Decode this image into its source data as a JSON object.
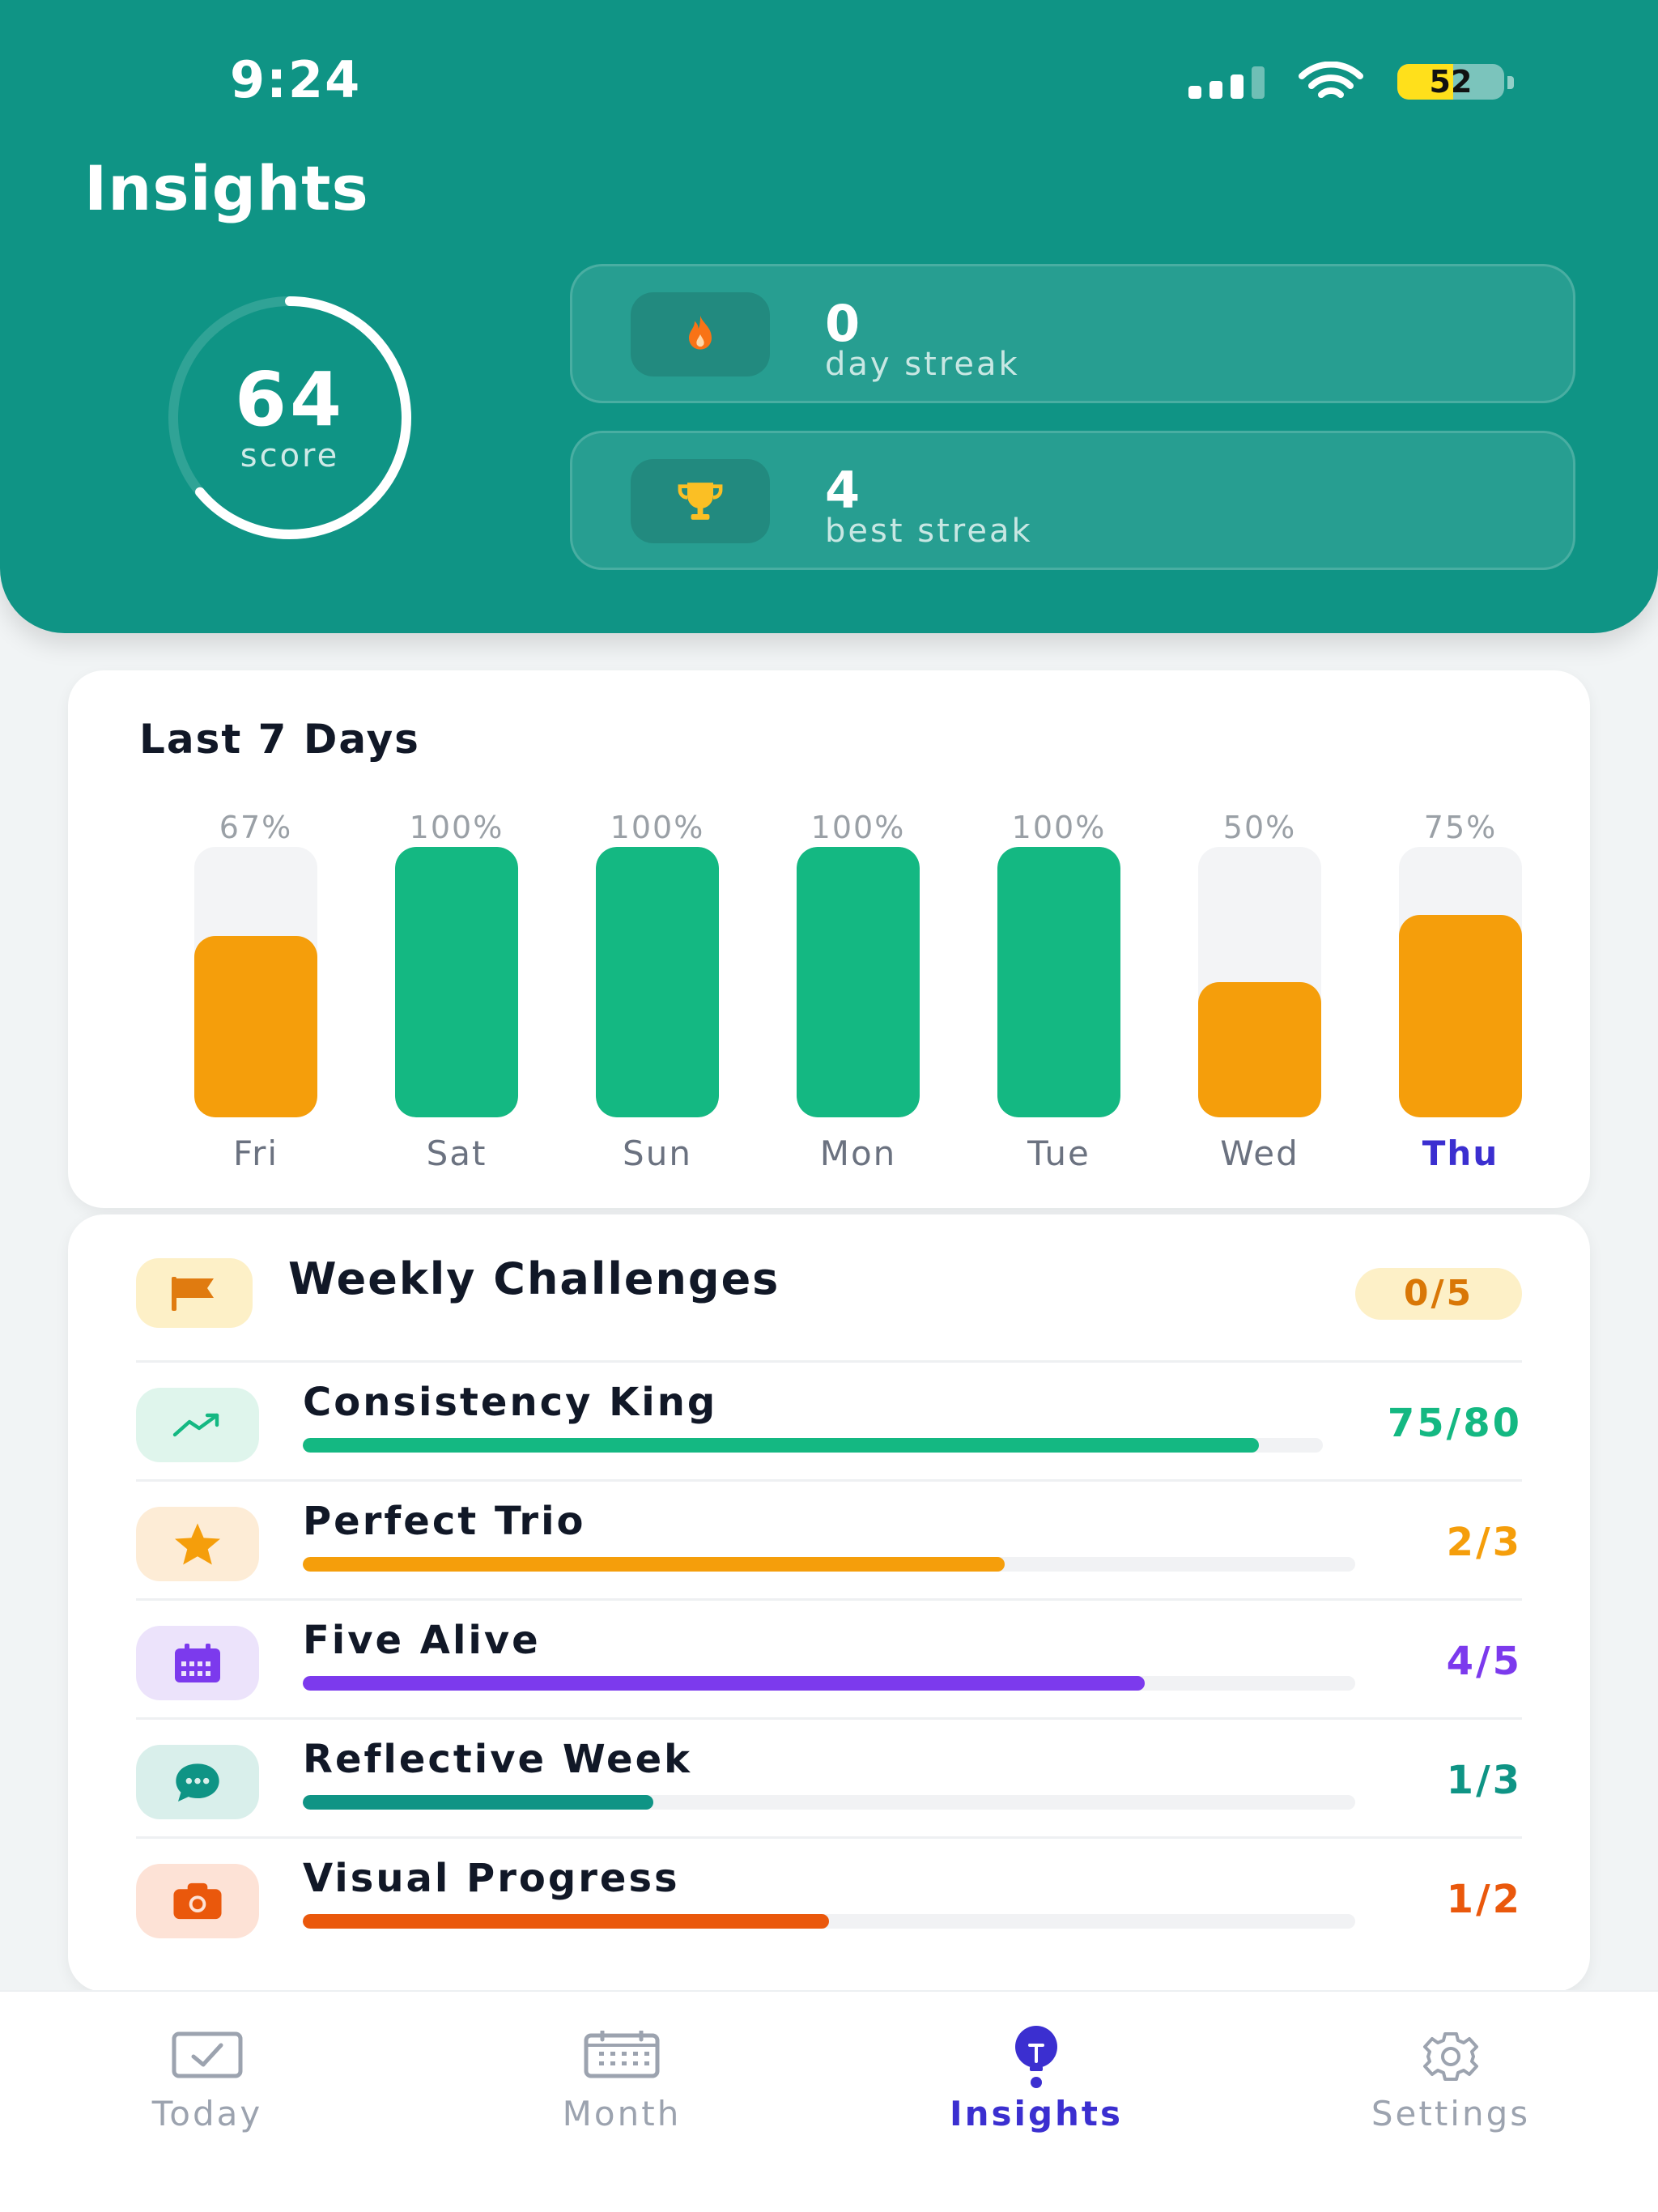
{
  "status_bar": {
    "time": "9:24",
    "battery": "52",
    "battery_level": 0.52,
    "icons": [
      "signal-icon",
      "wifi-icon",
      "battery-icon"
    ]
  },
  "header": {
    "title": "Insights",
    "score": {
      "value": "64",
      "label": "score",
      "progress": 0.64
    },
    "stats": [
      {
        "value": "0",
        "label": "day streak",
        "icon": "flame-icon",
        "icon_color": "#f97316"
      },
      {
        "value": "4",
        "label": "best streak",
        "icon": "trophy-icon",
        "icon_color": "#fbbf24"
      }
    ]
  },
  "last7": {
    "title": "Last 7 Days",
    "chart_data": {
      "type": "bar",
      "categories": [
        "Fri",
        "Sat",
        "Sun",
        "Mon",
        "Tue",
        "Wed",
        "Thu"
      ],
      "values": [
        67,
        100,
        100,
        100,
        100,
        50,
        75
      ],
      "labels": [
        "67%",
        "100%",
        "100%",
        "100%",
        "100%",
        "50%",
        "75%"
      ],
      "ylim": [
        0,
        100
      ],
      "highlight": "Thu",
      "colors": {
        "complete": "#14b882",
        "partial": "#f59e0b",
        "track": "#f3f4f6"
      }
    }
  },
  "challenges": {
    "title": "Weekly Challenges",
    "count": "0/5",
    "items": [
      {
        "name": "Consistency King",
        "value": "75/80",
        "progress": 0.9375,
        "color": "#14b882",
        "bg": "#dff5ec",
        "icon": "trend-up-icon"
      },
      {
        "name": "Perfect Trio",
        "value": "2/3",
        "progress": 0.6667,
        "color": "#f59e0b",
        "bg": "#fdecd6",
        "icon": "star-icon"
      },
      {
        "name": "Five Alive",
        "value": "4/5",
        "progress": 0.8,
        "color": "#7c3aed",
        "bg": "#ece3fb",
        "icon": "calendar-icon"
      },
      {
        "name": "Reflective Week",
        "value": "1/3",
        "progress": 0.3333,
        "color": "#0f9485",
        "bg": "#d9efeb",
        "icon": "chat-icon"
      },
      {
        "name": "Visual Progress",
        "value": "1/2",
        "progress": 0.5,
        "color": "#ea580c",
        "bg": "#fde2d6",
        "icon": "camera-icon"
      }
    ]
  },
  "tabs": [
    {
      "label": "Today",
      "icon": "checkbox-icon",
      "active": false
    },
    {
      "label": "Month",
      "icon": "calendar-icon",
      "active": false
    },
    {
      "label": "Insights",
      "icon": "lightbulb-icon",
      "active": true
    },
    {
      "label": "Settings",
      "icon": "gear-icon",
      "active": false
    }
  ],
  "colors": {
    "header_bg": "#0f9485",
    "accent": "#3b2fd0",
    "success": "#14b882",
    "warning": "#f59e0b"
  }
}
